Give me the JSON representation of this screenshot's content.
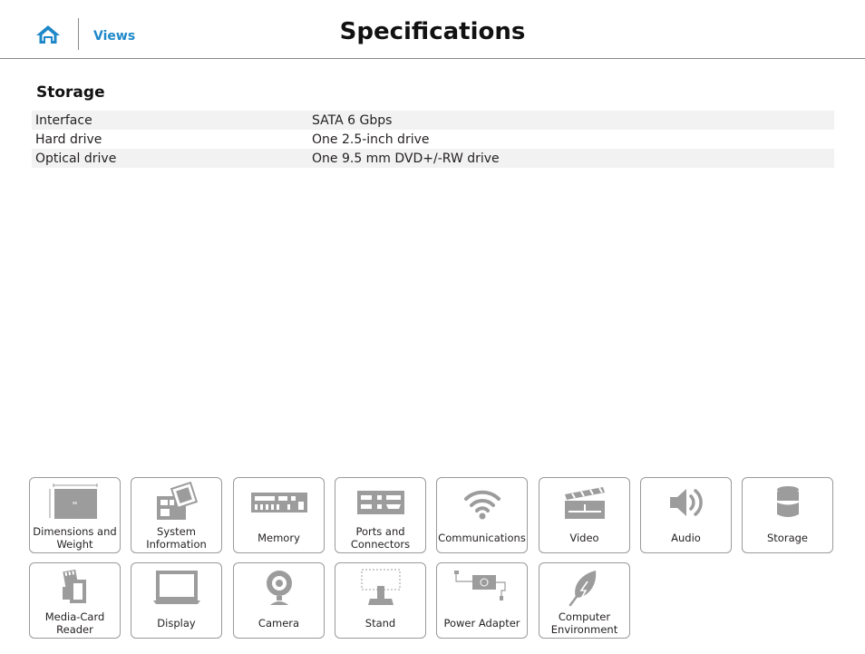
{
  "header": {
    "views_label": "Views",
    "title": "Specifications",
    "home_icon": "home-icon"
  },
  "section": {
    "title": "Storage",
    "rows": [
      {
        "label": "Interface",
        "value": "SATA 6 Gbps"
      },
      {
        "label": "Hard drive",
        "value": "One 2.5-inch drive"
      },
      {
        "label": "Optical drive",
        "value": "One 9.5 mm DVD+/-RW drive"
      }
    ]
  },
  "nav": {
    "tiles": [
      {
        "label": "Dimensions and Weight",
        "icon": "dimensions-icon"
      },
      {
        "label": "System Information",
        "icon": "system-board-icon"
      },
      {
        "label": "Memory",
        "icon": "memory-module-icon"
      },
      {
        "label": "Ports and Connectors",
        "icon": "ports-icon"
      },
      {
        "label": "Communications",
        "icon": "wifi-icon"
      },
      {
        "label": "Video",
        "icon": "clapperboard-icon"
      },
      {
        "label": "Audio",
        "icon": "speaker-icon"
      },
      {
        "label": "Storage",
        "icon": "storage-drum-icon"
      },
      {
        "label": "Media-Card Reader",
        "icon": "media-card-icon"
      },
      {
        "label": "Display",
        "icon": "display-icon"
      },
      {
        "label": "Camera",
        "icon": "webcam-icon"
      },
      {
        "label": "Stand",
        "icon": "stand-icon"
      },
      {
        "label": "Power Adapter",
        "icon": "power-adapter-icon"
      },
      {
        "label": "Computer Environment",
        "icon": "leaf-icon"
      }
    ]
  },
  "colors": {
    "accent": "#1e88c8",
    "icon_gray": "#9c9c9c",
    "row_shade": "#f2f2f2",
    "border": "#9a9a9a"
  }
}
